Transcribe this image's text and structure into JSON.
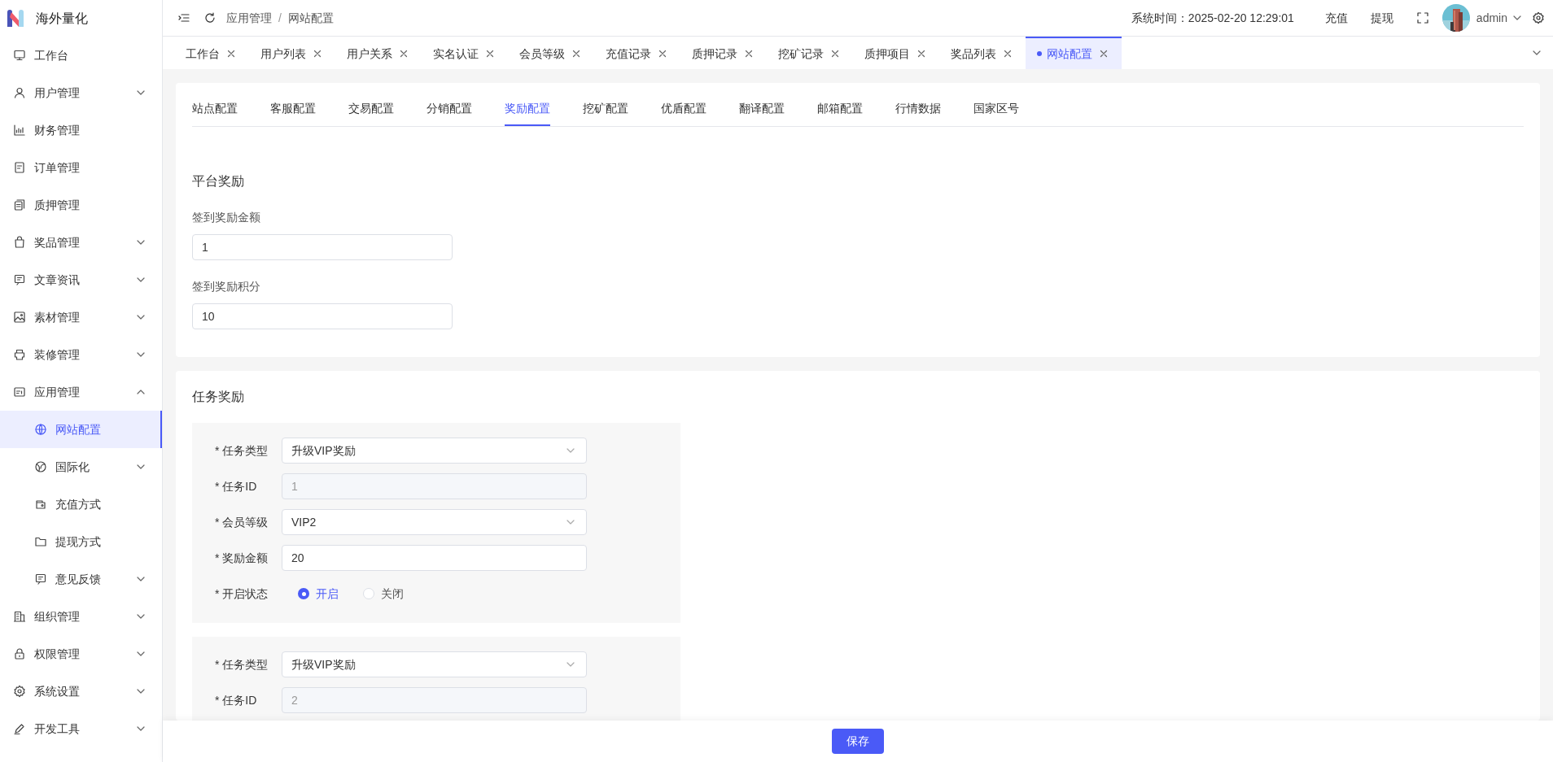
{
  "app": {
    "name": "海外量化"
  },
  "sidebar": {
    "items": [
      {
        "label": "工作台",
        "kind": "leaf",
        "selected": false
      },
      {
        "label": "用户管理",
        "kind": "group",
        "expanded": false,
        "selected": false
      },
      {
        "label": "财务管理",
        "kind": "leaf",
        "selected": false
      },
      {
        "label": "订单管理",
        "kind": "leaf",
        "selected": false
      },
      {
        "label": "质押管理",
        "kind": "leaf",
        "selected": false
      },
      {
        "label": "奖品管理",
        "kind": "group",
        "expanded": false,
        "selected": false
      },
      {
        "label": "文章资讯",
        "kind": "group",
        "expanded": false,
        "selected": false
      },
      {
        "label": "素材管理",
        "kind": "group",
        "expanded": false,
        "selected": false
      },
      {
        "label": "装修管理",
        "kind": "group",
        "expanded": false,
        "selected": false
      },
      {
        "label": "应用管理",
        "kind": "group",
        "expanded": true,
        "selected": false,
        "children": [
          {
            "label": "网站配置",
            "kind": "leaf",
            "selected": true
          },
          {
            "label": "国际化",
            "kind": "group",
            "expanded": false,
            "selected": false
          },
          {
            "label": "充值方式",
            "kind": "leaf",
            "selected": false
          },
          {
            "label": "提现方式",
            "kind": "leaf",
            "selected": false
          },
          {
            "label": "意见反馈",
            "kind": "group",
            "expanded": false,
            "selected": false
          }
        ]
      },
      {
        "label": "组织管理",
        "kind": "group",
        "expanded": false,
        "selected": false
      },
      {
        "label": "权限管理",
        "kind": "group",
        "expanded": false,
        "selected": false
      },
      {
        "label": "系统设置",
        "kind": "group",
        "expanded": false,
        "selected": false
      },
      {
        "label": "开发工具",
        "kind": "group",
        "expanded": false,
        "selected": false
      }
    ]
  },
  "header": {
    "breadcrumb": [
      "应用管理",
      "网站配置"
    ],
    "separator": "/",
    "system_time": "系统时间：2025-02-20 12:29:01",
    "links": [
      "充值",
      "提现"
    ],
    "user": "admin"
  },
  "page_tabs": [
    {
      "label": "工作台",
      "selected": false
    },
    {
      "label": "用户列表",
      "selected": false
    },
    {
      "label": "用户关系",
      "selected": false
    },
    {
      "label": "实名认证",
      "selected": false
    },
    {
      "label": "会员等级",
      "selected": false
    },
    {
      "label": "充值记录",
      "selected": false
    },
    {
      "label": "质押记录",
      "selected": false
    },
    {
      "label": "挖矿记录",
      "selected": false
    },
    {
      "label": "质押项目",
      "selected": false
    },
    {
      "label": "奖品列表",
      "selected": false
    },
    {
      "label": "网站配置",
      "selected": true
    }
  ],
  "config_tabs": [
    {
      "label": "站点配置",
      "selected": false
    },
    {
      "label": "客服配置",
      "selected": false
    },
    {
      "label": "交易配置",
      "selected": false
    },
    {
      "label": "分销配置",
      "selected": false
    },
    {
      "label": "奖励配置",
      "selected": true
    },
    {
      "label": "挖矿配置",
      "selected": false
    },
    {
      "label": "优盾配置",
      "selected": false
    },
    {
      "label": "翻译配置",
      "selected": false
    },
    {
      "label": "邮箱配置",
      "selected": false
    },
    {
      "label": "行情数据",
      "selected": false
    },
    {
      "label": "国家区号",
      "selected": false
    }
  ],
  "platform_reward": {
    "title": "平台奖励",
    "fields": [
      {
        "label": "签到奖励金额",
        "value": "1"
      },
      {
        "label": "签到奖励积分",
        "value": "10"
      }
    ]
  },
  "task_reward": {
    "title": "任务奖励",
    "tasks": [
      {
        "fields": [
          {
            "label": "* 任务类型",
            "kind": "select",
            "value": "升级VIP奖励"
          },
          {
            "label": "* 任务ID",
            "kind": "disabled",
            "value": "1"
          },
          {
            "label": "* 会员等级",
            "kind": "select",
            "value": "VIP2"
          },
          {
            "label": "* 奖励金额",
            "kind": "input",
            "value": "20"
          },
          {
            "label": "* 开启状态",
            "kind": "radio",
            "options": [
              {
                "label": "开启",
                "selected": true
              },
              {
                "label": "关闭",
                "selected": false
              }
            ]
          }
        ]
      },
      {
        "fields": [
          {
            "label": "* 任务类型",
            "kind": "select",
            "value": "升级VIP奖励"
          },
          {
            "label": "* 任务ID",
            "kind": "disabled",
            "value": "2"
          }
        ]
      }
    ]
  },
  "save_button": "保存"
}
